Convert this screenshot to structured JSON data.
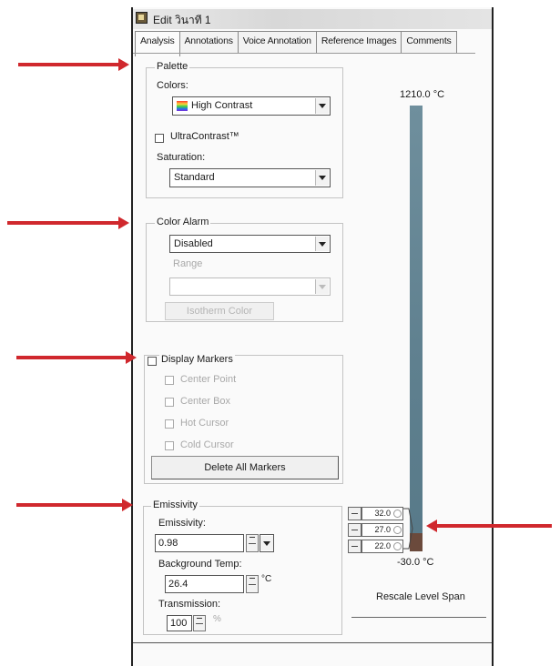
{
  "window": {
    "title": "Edit วินาที 1"
  },
  "tabs": [
    {
      "label": "Analysis",
      "active": true
    },
    {
      "label": "Annotations",
      "active": false
    },
    {
      "label": "Voice Annotation",
      "active": false
    },
    {
      "label": "Reference Images",
      "active": false
    },
    {
      "label": "Comments",
      "active": false
    }
  ],
  "palette": {
    "legend": "Palette",
    "colors_label": "Colors:",
    "colors_value": "High Contrast",
    "ultracontrast_label": "UltraContrast™",
    "saturation_label": "Saturation:",
    "saturation_value": "Standard"
  },
  "color_alarm": {
    "legend": "Color Alarm",
    "mode_value": "Disabled",
    "range_label": "Range",
    "range_value": "",
    "isotherm_button": "Isotherm Color"
  },
  "markers": {
    "legend": "Display Markers",
    "items": [
      "Center Point",
      "Center Box",
      "Hot Cursor",
      "Cold Cursor"
    ],
    "delete_button": "Delete All Markers"
  },
  "emissivity": {
    "legend": "Emissivity",
    "emissivity_label": "Emissivity:",
    "emissivity_value": "0.98",
    "background_label": "Background Temp:",
    "background_value": "26.4",
    "background_unit": "°C",
    "transmission_label": "Transmission:",
    "transmission_value": "100",
    "transmission_unit": "%"
  },
  "scale": {
    "max_label": "1210.0 °C",
    "min_label": "-30.0 °C",
    "markers": [
      "32.0",
      "27.0",
      "22.0"
    ],
    "rescale_label": "Rescale Level  Span"
  },
  "colors": {
    "annotation_arrow": "#d0282d",
    "scale_bar": "#6a8b99",
    "scale_low": "#6b4a3c"
  }
}
